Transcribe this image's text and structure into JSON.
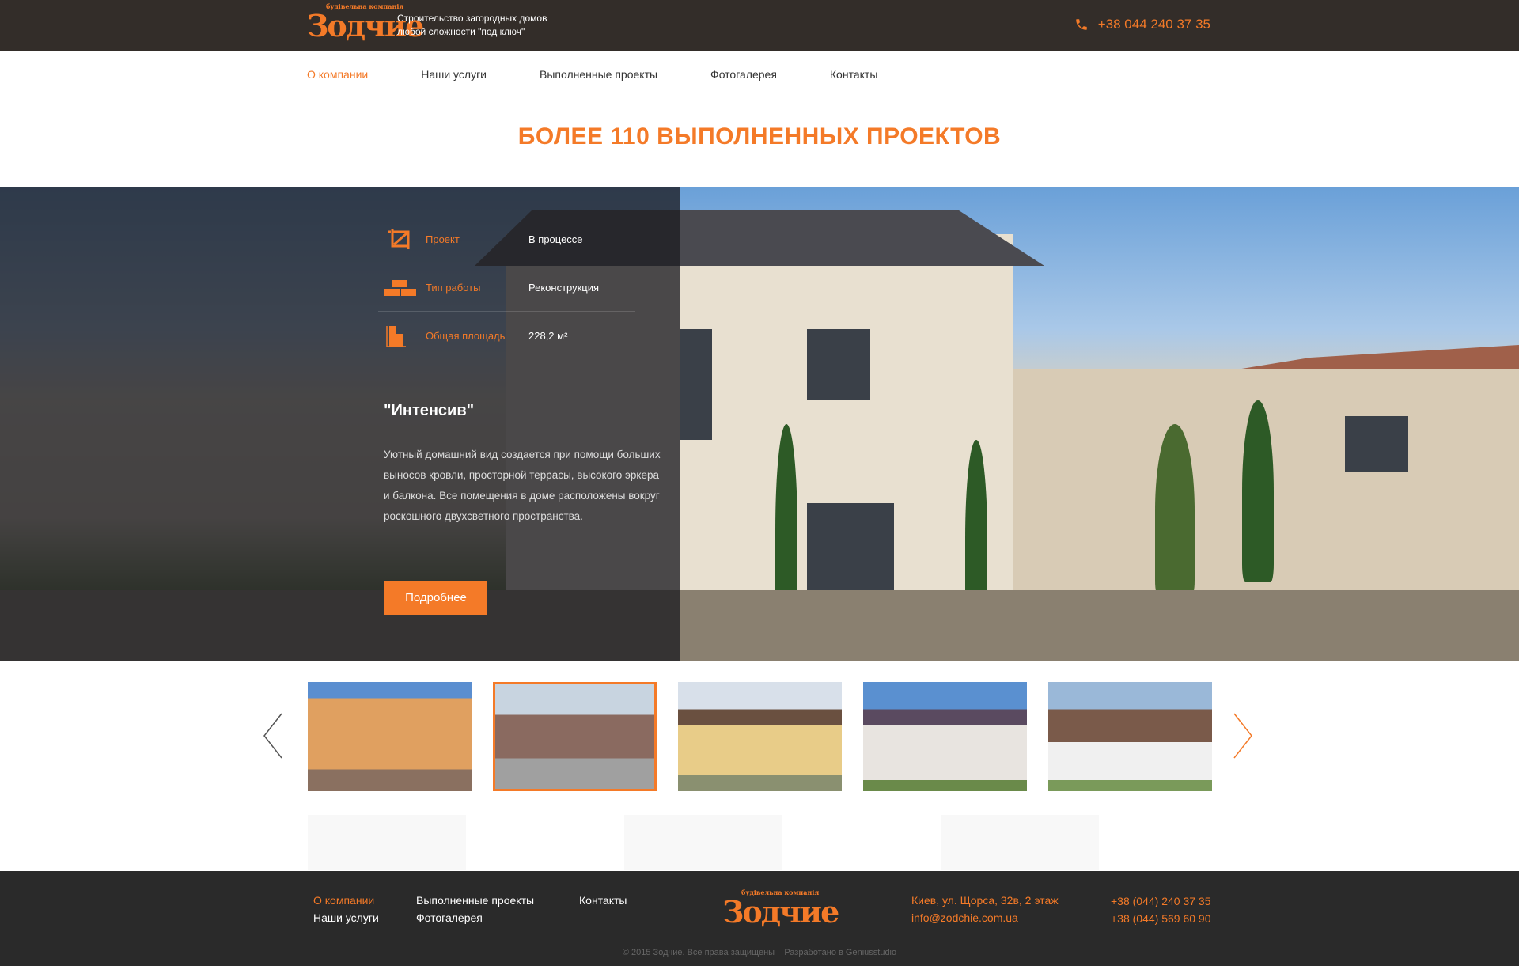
{
  "header": {
    "logo_small": "будівельна компанія",
    "logo_big": "Зодчие",
    "tagline_1": "Строительство загородных домов",
    "tagline_2": "любой сложности \"под ключ\"",
    "phone": "+38 044 240 37 35"
  },
  "nav": {
    "items": [
      "О компании",
      "Наши услуги",
      "Выполненные проекты",
      "Фотогалерея",
      "Контакты"
    ]
  },
  "title": "БОЛЕЕ 110 ВЫПОЛНЕННЫХ ПРОЕКТОВ",
  "project": {
    "rows": [
      {
        "label": "Проект",
        "value": "В процессе"
      },
      {
        "label": "Тип работы",
        "value": "Реконструкция"
      },
      {
        "label": "Общая площадь",
        "value": "228,2 м²"
      }
    ],
    "name": "\"Интенсив\"",
    "description": "Уютный домашний вид создается при помощи больших выносов кровли, просторной террасы, высокого эркера и балкона. Все помещения в доме расположены вокруг роскошного двухсветного пространства.",
    "button": "Подробнее"
  },
  "footer": {
    "links": [
      "О компании",
      "Наши услуги",
      "Выполненные проекты",
      "Фотогалерея",
      "Контакты"
    ],
    "address": "Киев, ул. Щорса, 32в, 2 этаж",
    "email": "info@zodchie.com.ua",
    "phone_1": "+38 (044) 240 37 35",
    "phone_2": "+38 (044) 569 60 90",
    "copyright": "© 2015 Зодчие. Все права защищены",
    "developer": "Разработано в Geniusstudio"
  },
  "colors": {
    "accent": "#f47a28",
    "header_bg": "#332d29",
    "footer_bg": "#2a2a2a"
  }
}
